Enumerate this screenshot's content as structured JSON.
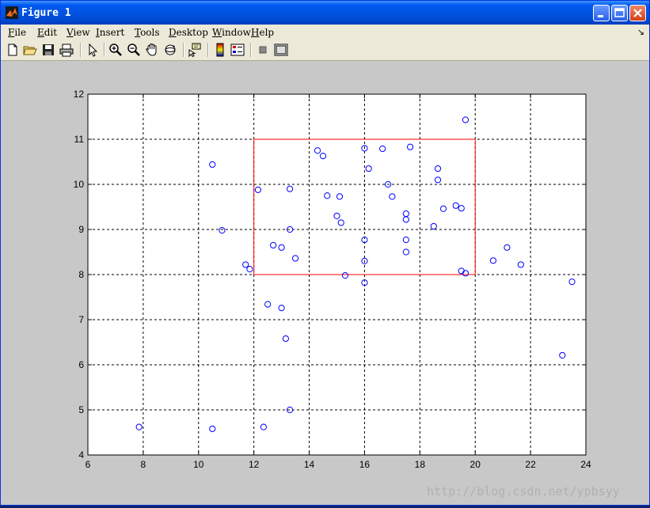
{
  "window": {
    "title": "Figure 1"
  },
  "menu": {
    "items": [
      {
        "key": "F",
        "rest": "ile"
      },
      {
        "key": "E",
        "rest": "dit"
      },
      {
        "key": "V",
        "rest": "iew"
      },
      {
        "key": "I",
        "rest": "nsert"
      },
      {
        "key": "T",
        "rest": "ools"
      },
      {
        "key": "D",
        "rest": "esktop"
      },
      {
        "key": "W",
        "rest": "indow"
      },
      {
        "key": "H",
        "rest": "elp"
      }
    ]
  },
  "toolbar": {
    "icons": [
      "new-file-icon",
      "open-file-icon",
      "save-icon",
      "print-icon",
      "pointer-icon",
      "zoom-in-icon",
      "zoom-out-icon",
      "pan-icon",
      "rotate-icon",
      "data-cursor-icon",
      "colorbar-icon",
      "legend-icon",
      "plot-tools-hide-icon",
      "plot-tools-show-icon"
    ]
  },
  "watermark": "http://blog.csdn.net/ypbsyy",
  "chart_data": {
    "type": "scatter",
    "xlim": [
      6,
      24
    ],
    "ylim": [
      4,
      12
    ],
    "xticks": [
      6,
      8,
      10,
      12,
      14,
      16,
      18,
      20,
      22,
      24
    ],
    "yticks": [
      4,
      5,
      6,
      7,
      8,
      9,
      10,
      11,
      12
    ],
    "grid": true,
    "marker_color": "#0000ff",
    "rectangle": {
      "x": [
        12,
        20
      ],
      "y": [
        8,
        11
      ],
      "color": "#ff0000"
    },
    "points": [
      [
        7.85,
        4.62
      ],
      [
        10.5,
        4.58
      ],
      [
        10.5,
        10.44
      ],
      [
        10.85,
        8.98
      ],
      [
        11.7,
        8.22
      ],
      [
        11.85,
        8.12
      ],
      [
        12.15,
        9.88
      ],
      [
        12.35,
        4.62
      ],
      [
        12.5,
        7.34
      ],
      [
        12.7,
        8.65
      ],
      [
        13.0,
        8.6
      ],
      [
        13.0,
        7.26
      ],
      [
        13.15,
        6.58
      ],
      [
        13.3,
        9.9
      ],
      [
        13.3,
        9.0
      ],
      [
        13.3,
        5.0
      ],
      [
        13.5,
        8.36
      ],
      [
        14.3,
        10.75
      ],
      [
        14.5,
        10.63
      ],
      [
        14.65,
        9.75
      ],
      [
        15.0,
        9.3
      ],
      [
        15.1,
        9.73
      ],
      [
        15.15,
        9.15
      ],
      [
        15.3,
        7.98
      ],
      [
        16.0,
        10.8
      ],
      [
        16.0,
        8.77
      ],
      [
        16.0,
        8.3
      ],
      [
        16.0,
        7.82
      ],
      [
        16.15,
        10.35
      ],
      [
        16.65,
        10.79
      ],
      [
        16.85,
        10.0
      ],
      [
        17.0,
        9.73
      ],
      [
        17.5,
        9.35
      ],
      [
        17.5,
        9.22
      ],
      [
        17.5,
        8.77
      ],
      [
        17.5,
        8.5
      ],
      [
        17.65,
        10.83
      ],
      [
        18.5,
        9.07
      ],
      [
        18.65,
        10.35
      ],
      [
        18.65,
        10.1
      ],
      [
        18.85,
        9.46
      ],
      [
        19.3,
        9.53
      ],
      [
        19.5,
        9.47
      ],
      [
        19.5,
        8.08
      ],
      [
        19.65,
        8.03
      ],
      [
        19.65,
        11.43
      ],
      [
        20.65,
        8.31
      ],
      [
        21.15,
        8.6
      ],
      [
        21.65,
        8.22
      ],
      [
        23.15,
        6.21
      ],
      [
        23.5,
        7.84
      ]
    ]
  }
}
